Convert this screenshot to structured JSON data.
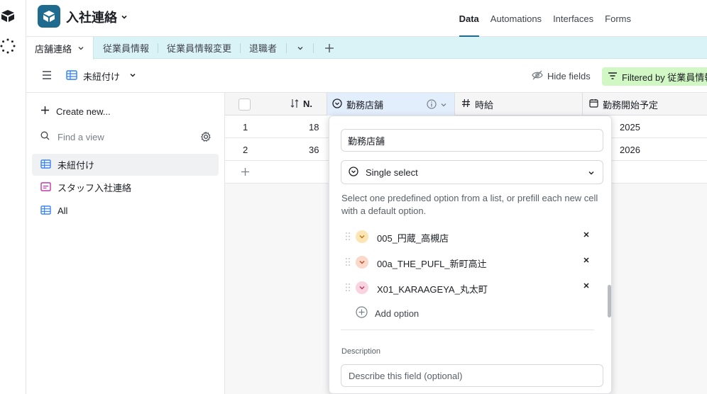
{
  "app": {
    "base_title": "入社連絡",
    "nav": [
      "Data",
      "Automations",
      "Interfaces",
      "Forms"
    ],
    "active_nav": "Data",
    "accent": "#1e6b8f"
  },
  "tabs": {
    "active": "店舗連絡",
    "items": [
      "従業員情報",
      "従業員情報変更",
      "退職者"
    ]
  },
  "viewbar": {
    "view_name": "未紐付け",
    "hide_fields": "Hide fields",
    "filtered": "Filtered by 従業員情報"
  },
  "sidebar": {
    "create_new": "Create new...",
    "find_placeholder": "Find a view",
    "views": [
      {
        "label": "未紐付け",
        "icon": "grid-icon"
      },
      {
        "label": "スタッフ入社連絡",
        "icon": "form-icon"
      },
      {
        "label": "All",
        "icon": "grid-icon"
      }
    ]
  },
  "grid": {
    "columns": [
      "N.",
      "勤務店舗",
      "時給",
      "勤務開始予定"
    ],
    "rows": [
      {
        "index": "1",
        "n": "18",
        "start": "2025"
      },
      {
        "index": "2",
        "n": "36",
        "start": "2026"
      }
    ]
  },
  "panel": {
    "field_name": "勤務店舗",
    "field_type": "Single select",
    "help_text": "Select one predefined option from a list, or prefill each new cell with a default option.",
    "options": [
      {
        "label": "005_円蔵_高槻店",
        "color": "#fde6b3",
        "chevron": "#b87b1a"
      },
      {
        "label": "00a_THE_PUFL_新町高辻",
        "color": "#fbd8c9",
        "chevron": "#b8532a"
      },
      {
        "label": "X01_KARAAGEYA_丸太町",
        "color": "#f9d3df",
        "chevron": "#b73d66"
      }
    ],
    "add_option": "Add option",
    "description_label": "Description",
    "description_placeholder": "Describe this field (optional)"
  }
}
